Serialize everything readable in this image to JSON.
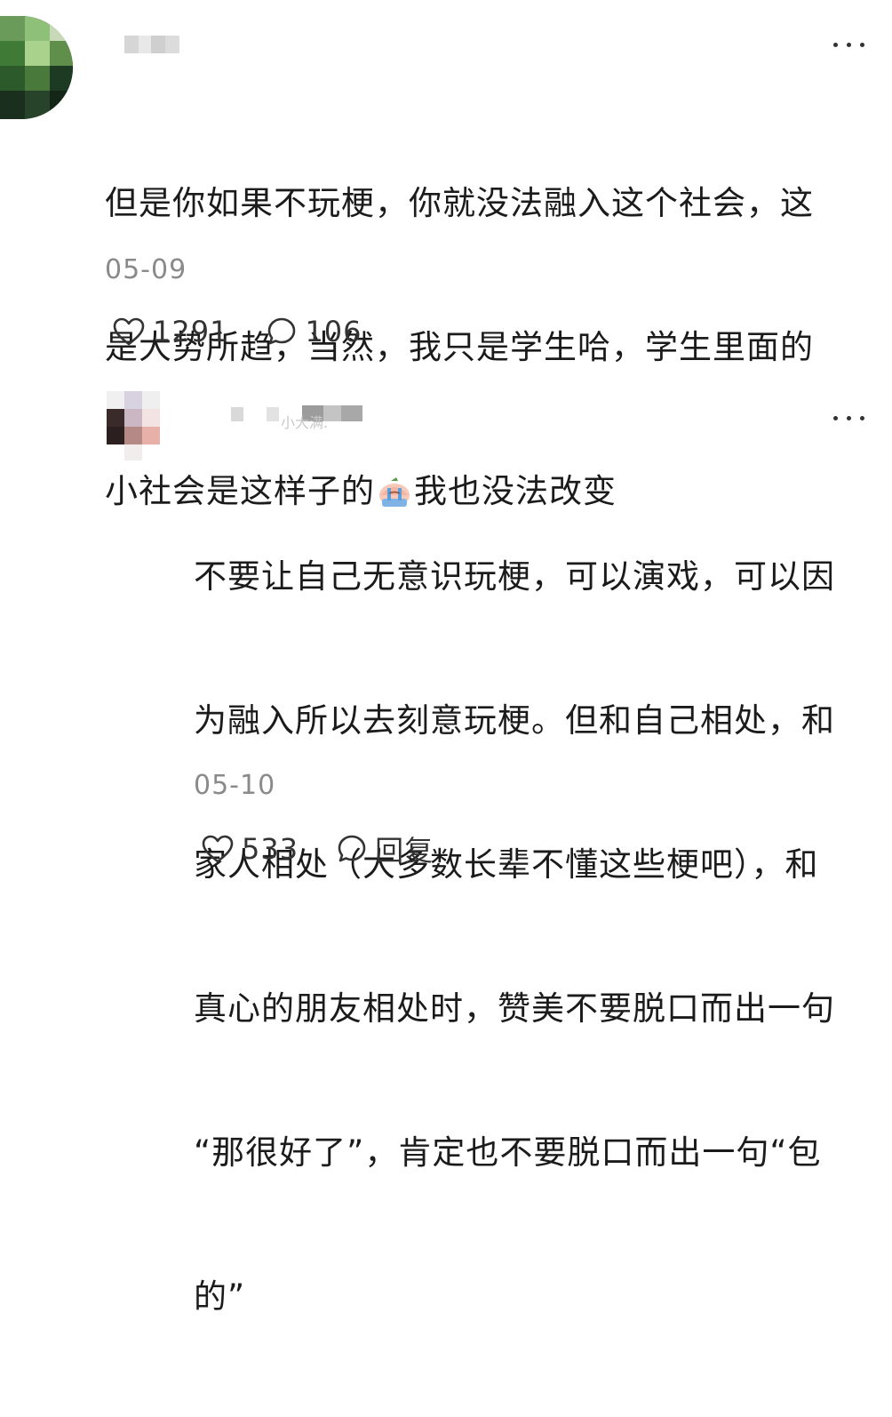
{
  "comments": [
    {
      "text_lines": [
        "但是你如果不玩梗，你就没法融入这个社会，这",
        "是大势所趋，当然，我只是学生哈，学生里面的",
        "小社会是这样子的",
        "我也没法改变"
      ],
      "emoji": "crying-face-emoji",
      "date": "05-09",
      "likes": "1291",
      "replies": "106"
    },
    {
      "username_partial": "小大满.",
      "text_lines": [
        "不要让自己无意识玩梗，可以演戏，可以因",
        "为融入所以去刻意玩梗。但和自己相处，和",
        "家人相处（大多数长辈不懂这些梗吧），和",
        "真心的朋友相处时，赞美不要脱口而出一句",
        "“那很好了”，肯定也不要脱口而出一句“包",
        "的”"
      ],
      "date": "05-10",
      "likes": "533",
      "reply_label": "回复"
    }
  ],
  "icons": {
    "like": "heart-outline-icon",
    "comment": "speech-bubble-icon",
    "more": "more-dots-icon"
  }
}
